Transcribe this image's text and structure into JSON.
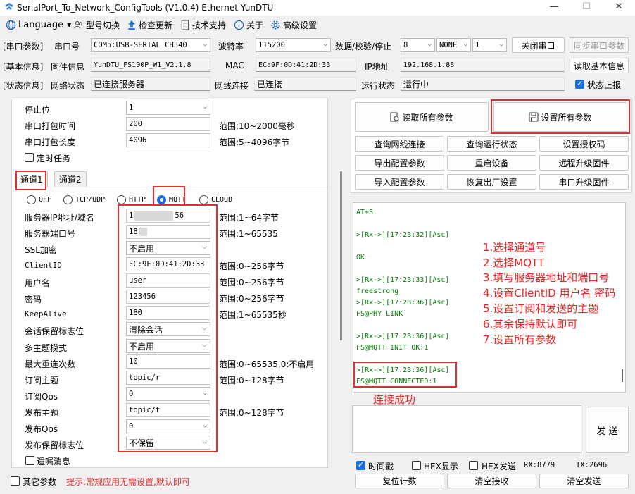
{
  "window": {
    "title": "SerialPort_To_Network_ConfigTools (V1.0.4) Ethernet YunDTU",
    "minimize": "—",
    "maximize": "☐",
    "close": "✕"
  },
  "menu": {
    "language": "Language",
    "model_switch": "型号切换",
    "check_update": "检查更新",
    "tech_support": "技术支持",
    "about": "关于",
    "advanced": "高级设置"
  },
  "serial": {
    "section": "[串口参数]",
    "port_label": "串口号",
    "port_value": "COM5:USB-SERIAL CH340",
    "baud_label": "波特率",
    "baud_value": "115200",
    "dps_label": "数据/校验/停止",
    "data_bits": "8",
    "parity": "NONE",
    "stop_bits": "1",
    "close_btn": "关闭串口",
    "sync_btn": "同步串口参数"
  },
  "basic": {
    "section": "[基本信息]",
    "fw_label": "固件信息",
    "fw_value": "YunDTU_FS100P_W1_V2.1.8",
    "mac_label": "MAC",
    "mac_value": "EC:9F:0D:41:2D:33",
    "ip_label": "IP地址",
    "ip_value": "192.168.1.88",
    "read_btn": "读取基本信息"
  },
  "status": {
    "section": "[状态信息]",
    "net_label": "网络状态",
    "net_value": "已连接服务器",
    "phy_label": "网线连接",
    "phy_value": "已连接",
    "run_label": "运行状态",
    "run_value": "运行中",
    "report_label": "状态上报"
  },
  "left": {
    "stop_bit_label": "停止位",
    "stop_bit_value": "1",
    "pack_time_label": "串口打包时间",
    "pack_time_value": "200",
    "pack_time_hint": "范围:10~2000毫秒",
    "pack_len_label": "串口打包长度",
    "pack_len_value": "4096",
    "pack_len_hint": "范围:5~4096字节",
    "timer_label": "定时任务",
    "tab1": "通道1",
    "tab2": "通道2",
    "protocols": [
      "OFF",
      "TCP/UDP",
      "HTTP",
      "MQTT",
      "CLOUD"
    ],
    "server_label": "服务器IP地址/域名",
    "server_value_a": "1",
    "server_value_b": "56",
    "server_hint": "范围:1~64字节",
    "port_label": "服务器端口号",
    "port_value": "18",
    "port_hint": "范围:1~65535",
    "ssl_label": "SSL加密",
    "ssl_value": "不启用",
    "clientid_label": "ClientID",
    "clientid_value": "EC:9F:0D:41:2D:33",
    "clientid_hint": "范围:0~256字节",
    "user_label": "用户名",
    "user_value": "user",
    "user_hint": "范围:0~256字节",
    "pass_label": "密码",
    "pass_value": "123456",
    "pass_hint": "范围:0~256字节",
    "keepalive_label": "KeepAlive",
    "keepalive_value": "180",
    "keepalive_hint": "范围:1~65535秒",
    "session_label": "会话保留标志位",
    "session_value": "清除会话",
    "multi_label": "多主题模式",
    "multi_value": "不启用",
    "retry_label": "最大重连次数",
    "retry_value": "10",
    "retry_hint": "范围:0~65535,0:不启用",
    "sub_topic_label": "订阅主题",
    "sub_topic_value": "topic/r",
    "sub_topic_hint": "范围:0~128字节",
    "sub_qos_label": "订阅Qos",
    "sub_qos_value": "0",
    "pub_topic_label": "发布主题",
    "pub_topic_value": "topic/t",
    "pub_topic_hint": "范围:0~128字节",
    "pub_qos_label": "发布Qos",
    "pub_qos_value": "0",
    "pub_retain_label": "发布保留标志位",
    "pub_retain_value": "不保留",
    "will_label": "遗嘱消息",
    "other_label": "其它参数",
    "tip": "提示:常规应用无需设置,默认即可"
  },
  "right": {
    "read_all": "读取所有参数",
    "set_all": "设置所有参数",
    "buttons": [
      [
        "查询网线连接",
        "查询运行状态",
        "设置授权码"
      ],
      [
        "导出配置参数",
        "重启设备",
        "远程升级固件"
      ],
      [
        "导入配置参数",
        "恢复出厂设置",
        "串口升级固件"
      ]
    ],
    "console": [
      "AT+S",
      ">[Rx->][17:23:32][Asc]",
      "OK",
      ">[Rx->][17:23:33][Asc]",
      "freestrong",
      ">[Rx->][17:23:36][Asc]",
      "FS@PHY LINK",
      ">[Rx->][17:23:36][Asc]",
      "FS@MQTT INIT OK:1",
      ">[Rx->][17:23:36][Asc]",
      "FS@MQTT CONNECTED:1"
    ],
    "annotations": [
      "1.选择通道号",
      "2.选择MQTT",
      "3.填写服务器地址和端口号",
      "4.设置ClientID 用户名 密码",
      "5.设置订阅和发送的主题",
      "6.其余保持默认即可",
      "7.设置所有参数"
    ],
    "connected_note": "连接成功",
    "send_btn": "发 送",
    "timestamp": "时间戳",
    "hex_show": "HEX显示",
    "hex_send": "HEX发送",
    "rx": "RX:8779",
    "tx": "TX:2696",
    "reset_count": "复位计数",
    "clear_rx": "清空接收",
    "clear_tx": "清空发送"
  },
  "colors": {
    "accent": "#1a6fd6",
    "highlight_red": "#e03030",
    "console_green": "#007d00"
  }
}
